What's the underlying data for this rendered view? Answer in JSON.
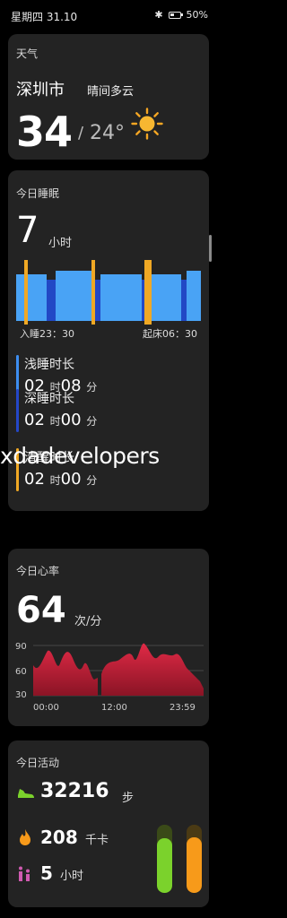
{
  "status_bar": {
    "time": "星期四 31.10",
    "battery": "50%",
    "battery_level": 0.5
  },
  "weather": {
    "title": "天气",
    "city": "深圳市",
    "condition": "晴间多云",
    "temp_high": "34",
    "temp_sep": "/",
    "temp_low": "24°",
    "icon": "sun-icon"
  },
  "sleep": {
    "title": "今日睡眠",
    "hours": "7",
    "hours_unit": "小时",
    "sleep_start": "入睡23：30",
    "wake_time": "起床06：30",
    "phases": [
      {
        "label": "浅睡时长",
        "h": "02",
        "m": "08",
        "h_unit": "时",
        "m_unit": "分",
        "color": "#3d8ef0"
      },
      {
        "label": "深睡时长",
        "h": "02",
        "m": "00",
        "h_unit": "时",
        "m_unit": "分",
        "color": "#2447c8"
      },
      {
        "label": "清醒时长",
        "h": "02",
        "m": "00",
        "h_unit": "时",
        "m_unit": "分",
        "color": "#f0a824"
      }
    ],
    "colors": {
      "light": "#3d8ef0",
      "deep": "#1e40c0",
      "awake": "#f0a824"
    }
  },
  "watermark": "xdadevelopers",
  "heart_rate": {
    "title": "今日心率",
    "value": "64",
    "unit": "次/分",
    "y_ticks": [
      "90",
      "60",
      "30"
    ],
    "x_ticks": [
      "00:00",
      "12:00",
      "23:59"
    ],
    "color": "#d8263f"
  },
  "activity": {
    "title": "今日活动",
    "steps": "32216",
    "steps_unit": "步",
    "calories": "208",
    "calories_unit": "千卡",
    "active_hours": "5",
    "active_hours_unit": "小时",
    "steps_progress": 0.8,
    "calories_progress": 0.82,
    "colors": {
      "steps": "#7bd22c",
      "calories": "#f79a1a",
      "hours": "#d05ab0"
    }
  }
}
